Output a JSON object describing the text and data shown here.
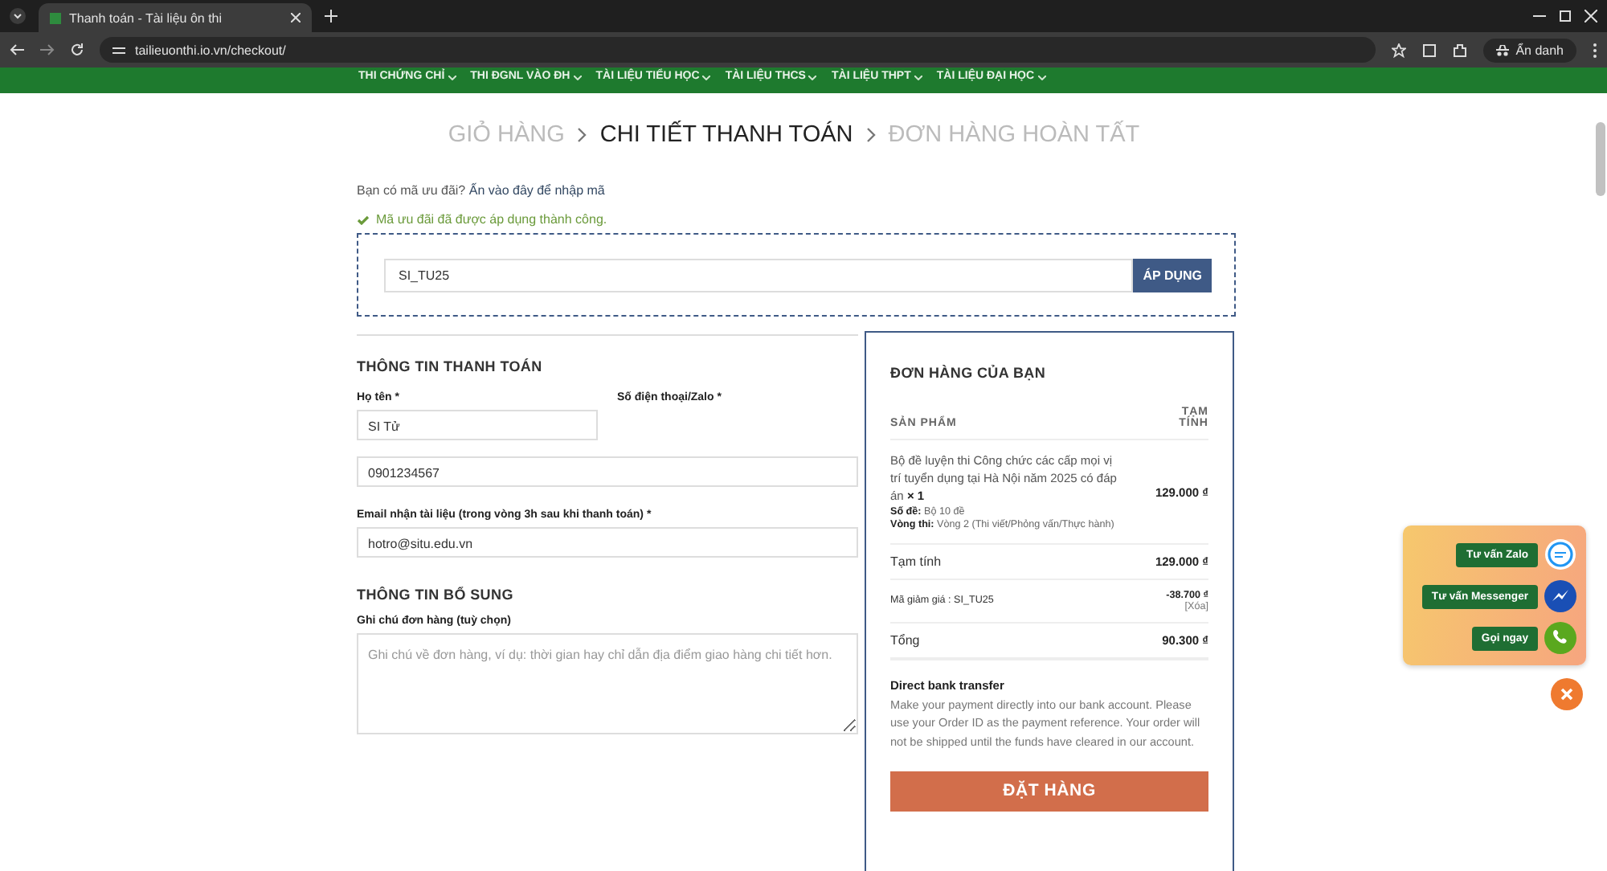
{
  "browser": {
    "tab_title": "Thanh toán - Tài liệu ôn thi",
    "url": "tailieuonthi.io.vn/checkout/",
    "profile_label": "Ẩn danh"
  },
  "nav": {
    "items": [
      "THI CHỨNG CHỈ",
      "THI ĐGNL VÀO ĐH",
      "TÀI LIỆU TIỂU HỌC",
      "TÀI LIỆU THCS",
      "TÀI LIỆU THPT",
      "TÀI LIỆU ĐẠI HỌC"
    ]
  },
  "breadcrumb": [
    {
      "label": "GIỎ HÀNG",
      "selected": false
    },
    {
      "label": "CHI TIẾT THANH TOÁN",
      "selected": true
    },
    {
      "label": "ĐƠN HÀNG HOÀN TẤT",
      "selected": false
    }
  ],
  "coupon": {
    "prompt": "Bạn có mã ưu đãi?",
    "link": "Ấn vào đây để nhập mã",
    "success": "Mã ưu đãi đã được áp dụng thành công.",
    "code": "SI_TU25",
    "button": "ÁP DỤNG"
  },
  "billing": {
    "heading": "THÔNG TIN THANH TOÁN",
    "fields": [
      {
        "label": "Họ tên *",
        "value": "SI Tử"
      },
      {
        "label": "Số điện thoại/Zalo *",
        "value": "0901234567"
      },
      {
        "label": "Email nhận tài liệu (trong vòng 3h sau khi thanh toán) *",
        "value": "hotro@situ.edu.vn"
      }
    ]
  },
  "additional": {
    "heading": "THÔNG TIN BỔ SUNG",
    "label": "Ghi chú đơn hàng (tuỳ chọn)",
    "placeholder": "Ghi chú về đơn hàng, ví dụ: thời gian hay chỉ dẫn địa điểm giao hàng chi tiết hơn."
  },
  "order": {
    "heading": "ĐƠN HÀNG CỦA BẠN",
    "columns": [
      "SẢN PHẨM",
      "TẠM TÍNH"
    ],
    "product": {
      "name": "Bộ đề luyện thi Công chức các cấp mọi vị trí tuyển dụng tại Hà Nội năm 2025 có đáp án",
      "quantity": "× 1",
      "price": "129.000 ₫",
      "meta": [
        {
          "key": "Số đề:",
          "value": "Bộ 10 đề"
        },
        {
          "key": "Vòng thi:",
          "value": "Vòng 2 (Thi viết/Phỏng vấn/Thực hành)"
        }
      ]
    },
    "subtotal": {
      "label": "Tạm tính",
      "value": "129.000 ₫"
    },
    "discount": {
      "label": "Mã giảm giá : SI_TU25",
      "value": "-38.700 ₫",
      "remove": "[Xóa]"
    },
    "total": {
      "label": "Tổng",
      "value": "90.300 ₫"
    },
    "payment": {
      "title": "Direct bank transfer",
      "description": "Make your payment directly into our bank account. Please use your Order ID as the payment reference. Your order will not be shipped until the funds have cleared in our account."
    },
    "button": "ĐẶT HÀNG"
  },
  "contact": {
    "buttons": [
      {
        "label": "Tư vấn Zalo",
        "kind": "zalo"
      },
      {
        "label": "Tư vấn Messenger",
        "kind": "messenger"
      },
      {
        "label": "Gọi ngay",
        "kind": "phone"
      }
    ]
  }
}
